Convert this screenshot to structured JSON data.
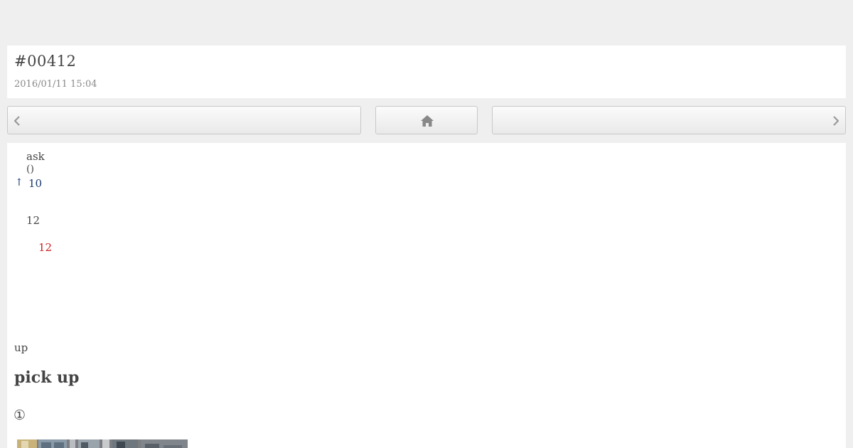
{
  "header": {
    "post_id": "#00412",
    "date": "2016/01/11 15:04"
  },
  "nav": {
    "prev_icon": "chevron-left-icon",
    "home_icon": "home-icon",
    "next_icon": "chevron-right-icon"
  },
  "content": {
    "ask": "ask",
    "paren": "()",
    "up_arrow": "↑",
    "up_count": "10",
    "number_plain": "12",
    "number_red": "12",
    "up_label": "up",
    "pick_up_heading": "pick up",
    "circled_number": "①"
  },
  "colors": {
    "background": "#efefef",
    "card": "#ffffff",
    "link_blue": "#1a3a6e",
    "highlight_red": "#d01f1f"
  }
}
